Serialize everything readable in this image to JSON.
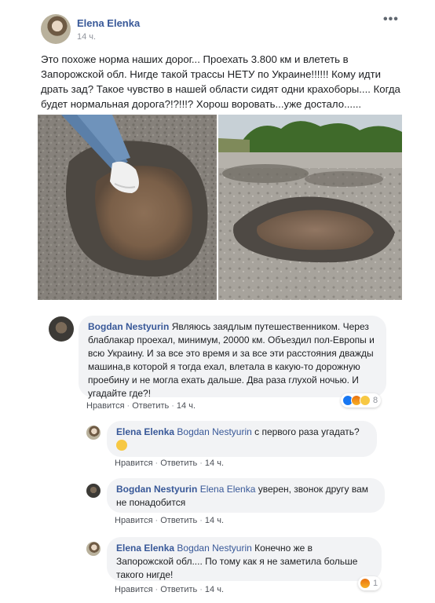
{
  "post": {
    "author": "Elena Elenka",
    "time": "14 ч.",
    "more": "•••",
    "text": "Это похоже норма наших дорог... Проехать 3.800 км и влететь в Запорожской обл. Нигде такой трассы НЕТУ по Украине!!!!!! Кому идти драть зад? Такое чувство в нашей области сидят одни крахоборы.... Когда будет нормальная дорога?!?!!!? Хорош воровать...уже достало......"
  },
  "comments": [
    {
      "author": "Bogdan Nestyurin",
      "mention": "",
      "text": "Являюсь заядлым путешественником. Через блаблакар проехал, минимум, 20000 км. Объездил пол-Европы и всю Украину. И за все это время и за все эти расстояния дважды машина,в которой я тогда ехал, влетала в какую-то дорожную проебину и не могла ехать дальше. Два раза глухой ночью. И угадайте где?!",
      "like": "Нравится",
      "reply": "Ответить",
      "time": "14 ч.",
      "reaction_count": "8"
    },
    {
      "author": "Elena Elenka",
      "mention": "Bogdan Nestyurin",
      "text": "с первого раза угадать?",
      "like": "Нравится",
      "reply": "Ответить",
      "time": "14 ч."
    },
    {
      "author": "Bogdan Nestyurin",
      "mention": "Elena Elenka",
      "text": "уверен, звонок другу вам не понадобится",
      "like": "Нравится",
      "reply": "Ответить",
      "time": "14 ч."
    },
    {
      "author": "Elena Elenka",
      "mention": "Bogdan Nestyurin",
      "text": "Конечно же в Запорожской обл.... По тому как я не заметила больше такого нигде!",
      "like": "Нравится",
      "reply": "Ответить",
      "time": "14 ч.",
      "reaction_count": "1"
    }
  ],
  "colors": {
    "link": "#385898",
    "bubble": "#f2f3f5",
    "meta": "#90949c"
  }
}
